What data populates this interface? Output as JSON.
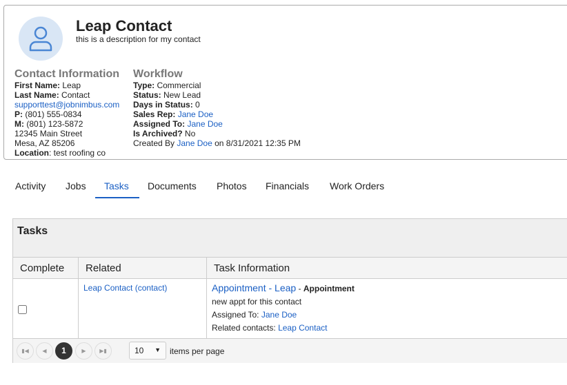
{
  "contact": {
    "name": "Leap Contact",
    "description": "this is a description for my contact",
    "info_heading": "Contact Information",
    "first_name_label": "First Name:",
    "first_name": "Leap",
    "last_name_label": "Last Name:",
    "last_name": "Contact",
    "email": "supporttest@jobnimbus.com",
    "phone_label": "P:",
    "phone": "(801) 555-0834",
    "mobile_label": "M:",
    "mobile": "(801) 123-5872",
    "address1": "12345 Main Street",
    "address2": "Mesa, AZ 85206",
    "location_label": "Location",
    "location": ": test roofing co"
  },
  "workflow": {
    "heading": "Workflow",
    "type_label": "Type:",
    "type": "Commercial",
    "status_label": "Status:",
    "status": "New Lead",
    "days_label": "Days in Status:",
    "days": "0",
    "sales_rep_label": "Sales Rep:",
    "sales_rep": "Jane Doe",
    "assigned_label": "Assigned To:",
    "assigned": "Jane Doe",
    "archived_label": "Is Archived?",
    "archived": "No",
    "created_prefix": "Created By",
    "created_by": "Jane Doe",
    "created_on": "on 8/31/2021 12:35 PM"
  },
  "tabs": [
    {
      "label": "Activity"
    },
    {
      "label": "Jobs"
    },
    {
      "label": "Tasks",
      "active": true
    },
    {
      "label": "Documents"
    },
    {
      "label": "Photos"
    },
    {
      "label": "Financials"
    },
    {
      "label": "Work Orders"
    }
  ],
  "tasks": {
    "title": "Tasks",
    "columns": [
      "Complete",
      "Related",
      "Task Information"
    ],
    "rows": [
      {
        "complete": false,
        "related": "Leap Contact (contact)",
        "task_link": "Appointment - Leap",
        "task_sep": " - ",
        "task_type": "Appointment",
        "description": "new appt for this contact",
        "assigned_label": "Assigned To:",
        "assigned": "Jane Doe",
        "related_label": "Related contacts:",
        "related_contact": "Leap Contact"
      }
    ],
    "pager": {
      "current_page": "1",
      "page_size": "10",
      "items_per_page_label": "items per page"
    }
  },
  "colors": {
    "accent": "#1a5fc4"
  }
}
